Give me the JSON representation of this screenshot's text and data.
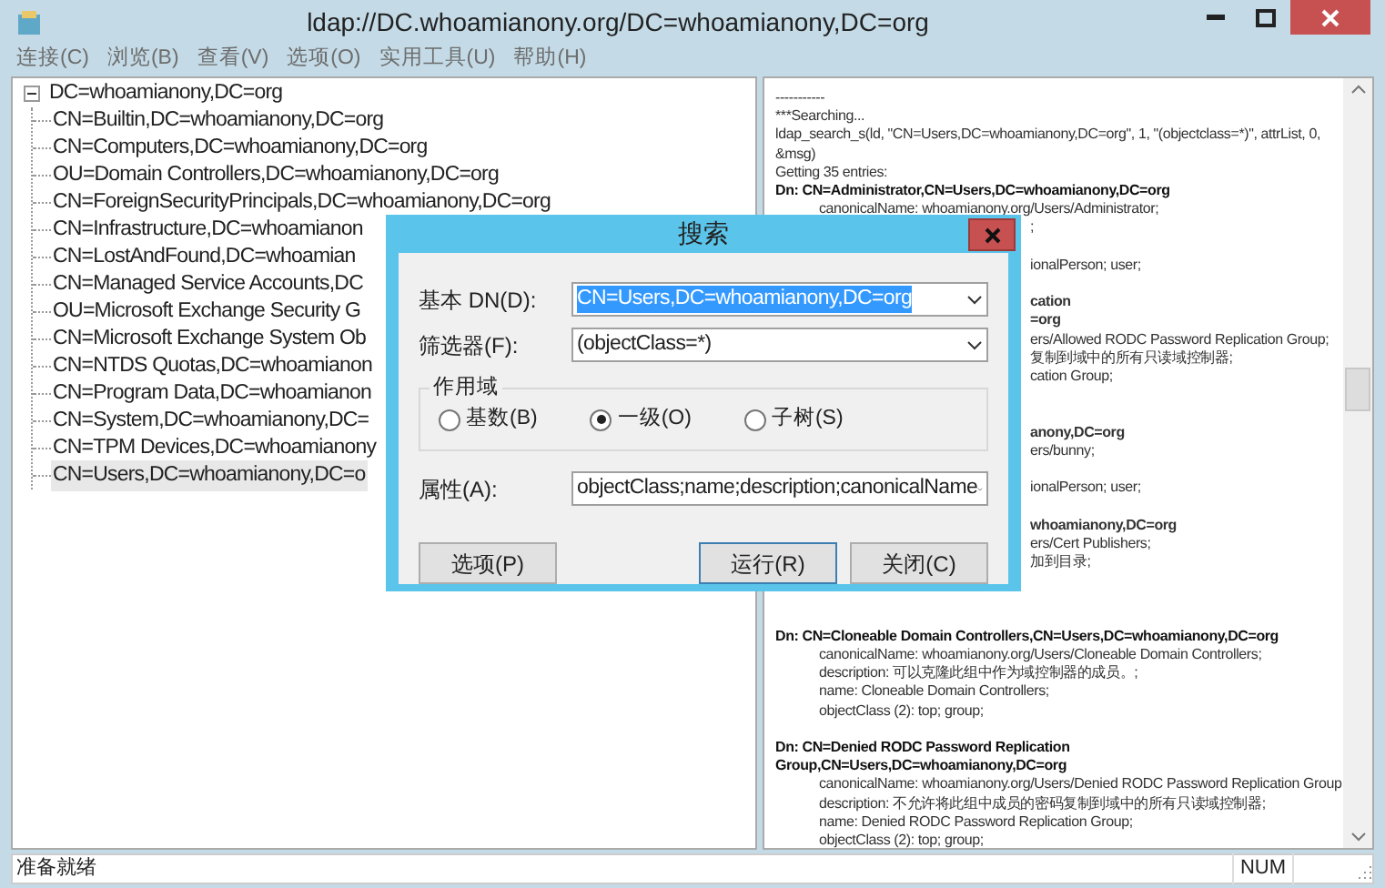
{
  "window": {
    "title": "ldap://DC.whoamianony.org/DC=whoamianony,DC=org"
  },
  "menu": [
    "连接(C)",
    "浏览(B)",
    "查看(V)",
    "选项(O)",
    "实用工具(U)",
    "帮助(H)"
  ],
  "tree": {
    "label": "DC=whoamianony,DC=org",
    "expanded": true,
    "selected": false,
    "children": [
      {
        "label": "CN=Builtin,DC=whoamianony,DC=org",
        "selected": false
      },
      {
        "label": "CN=Computers,DC=whoamianony,DC=org",
        "selected": false
      },
      {
        "label": "OU=Domain Controllers,DC=whoamianony,DC=org",
        "selected": false
      },
      {
        "label": "CN=ForeignSecurityPrincipals,DC=whoamianony,DC=org",
        "selected": false
      },
      {
        "label": "CN=Infrastructure,DC=whoamianon",
        "selected": false
      },
      {
        "label": "CN=LostAndFound,DC=whoamian",
        "selected": false
      },
      {
        "label": "CN=Managed Service Accounts,DC",
        "selected": false
      },
      {
        "label": "OU=Microsoft Exchange Security G",
        "selected": false
      },
      {
        "label": "CN=Microsoft Exchange System Ob",
        "selected": false
      },
      {
        "label": "CN=NTDS Quotas,DC=whoamianon",
        "selected": false
      },
      {
        "label": "CN=Program Data,DC=whoamianon",
        "selected": false
      },
      {
        "label": "CN=System,DC=whoamianony,DC=",
        "selected": false
      },
      {
        "label": "CN=TPM Devices,DC=whoamianony",
        "selected": false
      },
      {
        "label": "CN=Users,DC=whoamianony,DC=o",
        "selected": true
      }
    ]
  },
  "output": [
    {
      "kind": "plain",
      "text": "-----------"
    },
    {
      "kind": "plain",
      "text": "***Searching..."
    },
    {
      "kind": "plain",
      "text": "ldap_search_s(ld, \"CN=Users,DC=whoamianony,DC=org\", 1, \"(objectclass=*)\", attrList,  0, &msg)"
    },
    {
      "kind": "plain",
      "text": "Getting 35 entries:"
    },
    {
      "kind": "dn",
      "text": "Dn: CN=Administrator,CN=Users,DC=whoamianony,DC=org"
    },
    {
      "kind": "attr",
      "text": "canonicalName: whoamianony.org/Users/Administrator;"
    },
    {
      "kind": "clipped",
      "text": ";"
    },
    {
      "kind": "blank"
    },
    {
      "kind": "clipped",
      "text": "ionalPerson; user;"
    },
    {
      "kind": "blank"
    },
    {
      "kind": "clipped_dn",
      "text": "cation"
    },
    {
      "kind": "clipped_dn",
      "text": "=org"
    },
    {
      "kind": "clipped",
      "text": "ers/Allowed RODC Password Replication Group;"
    },
    {
      "kind": "clipped",
      "text": "复制到域中的所有只读域控制器;"
    },
    {
      "kind": "clipped",
      "text": "cation Group;"
    },
    {
      "kind": "blank"
    },
    {
      "kind": "blank"
    },
    {
      "kind": "clipped_dn",
      "text": "anony,DC=org"
    },
    {
      "kind": "clipped",
      "text": "ers/bunny;"
    },
    {
      "kind": "blank"
    },
    {
      "kind": "clipped",
      "text": "ionalPerson; user;"
    },
    {
      "kind": "blank"
    },
    {
      "kind": "clipped_dn",
      "text": "whoamianony,DC=org"
    },
    {
      "kind": "clipped",
      "text": "ers/Cert Publishers;"
    },
    {
      "kind": "clipped",
      "text": "加到目录;"
    },
    {
      "kind": "blank"
    },
    {
      "kind": "blank"
    },
    {
      "kind": "blank"
    },
    {
      "kind": "dn",
      "text": "Dn: CN=Cloneable Domain Controllers,CN=Users,DC=whoamianony,DC=org"
    },
    {
      "kind": "attr",
      "text": "canonicalName: whoamianony.org/Users/Cloneable Domain Controllers;"
    },
    {
      "kind": "attr",
      "text": "description: 可以克隆此组中作为域控制器的成员。;"
    },
    {
      "kind": "attr",
      "text": "name: Cloneable Domain Controllers;"
    },
    {
      "kind": "attr",
      "text": "objectClass (2): top; group;"
    },
    {
      "kind": "blank"
    },
    {
      "kind": "dn",
      "text": "Dn: CN=Denied RODC Password Replication Group,CN=Users,DC=whoamianony,DC=org"
    },
    {
      "kind": "attr",
      "text": "canonicalName: whoamianony.org/Users/Denied RODC Password Replication Group;"
    },
    {
      "kind": "attr",
      "text": "description: 不允许将此组中成员的密码复制到域中的所有只读域控制器;"
    },
    {
      "kind": "attr",
      "text": "name: Denied RODC Password Replication Group;"
    },
    {
      "kind": "attr",
      "text": "objectClass (2): top; group;"
    }
  ],
  "dialog": {
    "title": "搜索",
    "base_dn": {
      "label": "基本 DN(D):",
      "value": "CN=Users,DC=whoamianony,DC=org"
    },
    "filter": {
      "label": "筛选器(F):",
      "value": "(objectClass=*)"
    },
    "scope": {
      "label": "作用域",
      "options": [
        {
          "label": "基数(B)",
          "selected": false
        },
        {
          "label": "一级(O)",
          "selected": true
        },
        {
          "label": "子树(S)",
          "selected": false
        }
      ]
    },
    "attributes": {
      "label": "属性(A):",
      "value": "objectClass;name;description;canonicalName"
    },
    "buttons": [
      {
        "label": "选项(P)",
        "focused": false
      },
      {
        "label": "运行(R)",
        "focused": true
      },
      {
        "label": "关闭(C)",
        "focused": false
      }
    ]
  },
  "status_bar": {
    "text": "准备就绪",
    "indicator": "NUM"
  }
}
